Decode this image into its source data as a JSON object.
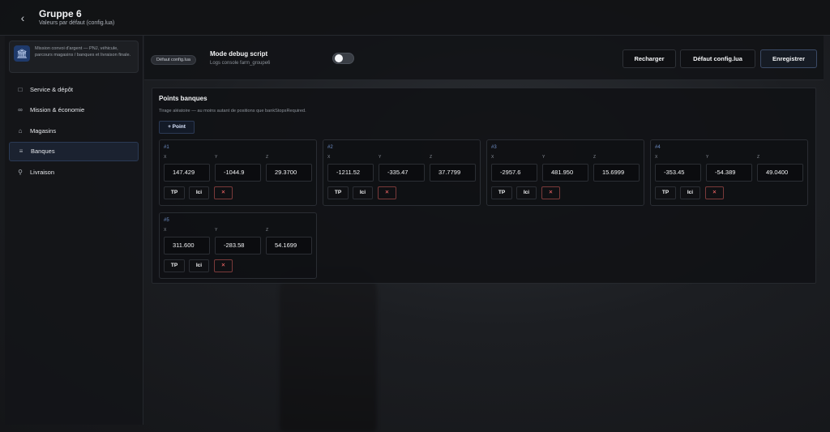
{
  "topbar": {
    "back_icon": "chevron-left-icon",
    "title": "Gruppe 6",
    "subtitle": "Valeurs par défaut (config.lua)"
  },
  "sidebar": {
    "mission_card": {
      "icon": "bank-icon",
      "text": "Mission convoi d'argent — PNJ, véhicule, parcours magasins / banques et livraison finale."
    },
    "items": [
      {
        "label": "Service & dépôt",
        "icon": "briefcase-icon",
        "active": false
      },
      {
        "label": "Mission & économie",
        "icon": "link-icon",
        "active": false
      },
      {
        "label": "Magasins",
        "icon": "store-icon",
        "active": false
      },
      {
        "label": "Banques",
        "icon": "bank-icon",
        "active": true
      },
      {
        "label": "Livraison",
        "icon": "map-pin-icon",
        "active": false
      }
    ]
  },
  "header": {
    "default_badge": "Défaut config.lua",
    "debug_title": "Mode debug script",
    "debug_subtitle": "Logs console farm_groupe6",
    "debug_enabled": false,
    "buttons": {
      "reload": "Recharger",
      "default": "Défaut config.lua",
      "save": "Enregistrer"
    }
  },
  "section": {
    "title": "Points banques",
    "subtitle": "Tirage aléatoire — au moins autant de positions que bankStopsRequired.",
    "add_button": "+ Point",
    "axis_labels": {
      "x": "X",
      "y": "Y",
      "z": "Z"
    },
    "tp_label": "TP",
    "ici_label": "Ici",
    "delete_label": "✕",
    "points": [
      {
        "label": "#1",
        "x": "147.429",
        "y": "-1044.9",
        "z": "29.3700"
      },
      {
        "label": "#2",
        "x": "-1211.52",
        "y": "-335.47",
        "z": "37.7799"
      },
      {
        "label": "#3",
        "x": "-2957.6",
        "y": "481.950",
        "z": "15.6999"
      },
      {
        "label": "#4",
        "x": "-353.45",
        "y": "-54.389",
        "z": "49.0400"
      },
      {
        "label": "#5",
        "x": "311.600",
        "y": "-283.58",
        "z": "54.1699"
      }
    ]
  },
  "colors": {
    "accent": "#6f8fc7",
    "delete": "#ff6b6b",
    "panel": "#111215"
  }
}
